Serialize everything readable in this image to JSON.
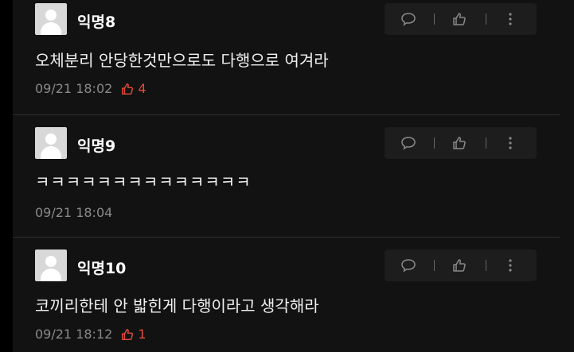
{
  "comments": [
    {
      "name": "익명8",
      "text": "오체분리 안당한것만으로도 다행으로 여겨라",
      "time": "09/21 18:02",
      "likes": "4"
    },
    {
      "name": "익명9",
      "text": "ㅋㅋㅋㅋㅋㅋㅋㅋㅋㅋㅋㅋㅋㅋ",
      "time": "09/21 18:04",
      "likes": ""
    },
    {
      "name": "익명10",
      "text": "코끼리한테 안 밟힌게 다행이라고 생각해라",
      "time": "09/21 18:12",
      "likes": "1"
    }
  ],
  "colors": {
    "background": "#121212",
    "like_accent": "#e14b3b",
    "meta": "#8a8a8a"
  },
  "icons": {
    "reply": "speech-bubble-icon",
    "like": "thumbs-up-icon",
    "more": "more-vertical-icon"
  }
}
